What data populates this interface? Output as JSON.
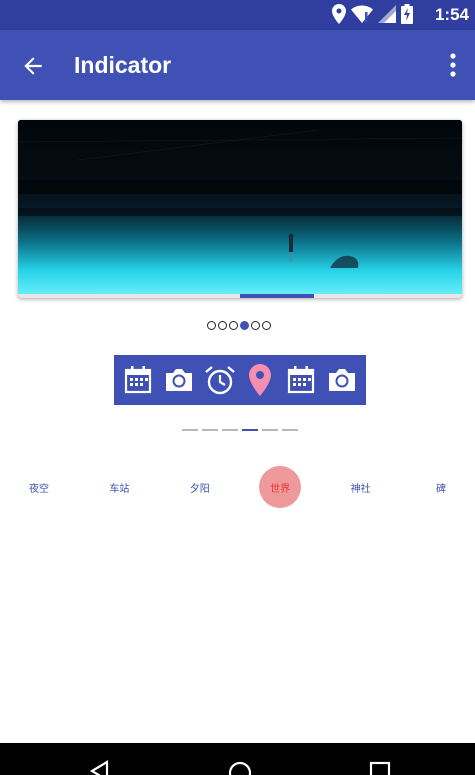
{
  "status_bar": {
    "time": "1:54",
    "icons": [
      "location-icon",
      "wifi-icon",
      "signal-icon",
      "battery-icon"
    ]
  },
  "app_bar": {
    "title": "Indicator",
    "back_icon": "arrow-back-icon",
    "overflow_icon": "more-vert-icon"
  },
  "banner": {
    "page_index": 3,
    "page_count": 6
  },
  "circle_indicator": {
    "count": 6,
    "selected": 3
  },
  "icon_tabs": {
    "items": [
      "calendar-icon",
      "camera-icon",
      "alarm-icon",
      "location-pin-icon",
      "calendar-icon",
      "camera-icon"
    ],
    "selected": 3
  },
  "line_indicator": {
    "count": 6,
    "selected": 3
  },
  "text_tabs": {
    "items": [
      "夜空",
      "车站",
      "夕阳",
      "世界",
      "神社",
      "碑"
    ],
    "selected": 3
  },
  "nav_bar": {
    "icons": [
      "back-triangle-icon",
      "home-circle-icon",
      "recents-square-icon"
    ]
  },
  "colors": {
    "primary": "#3f51b5",
    "primary_dark": "#303f9f",
    "active_text_tab_bg": "#ef9a9a",
    "active_text_tab_fg": "#e53935",
    "active_icon_tab": "#f48fb1"
  }
}
